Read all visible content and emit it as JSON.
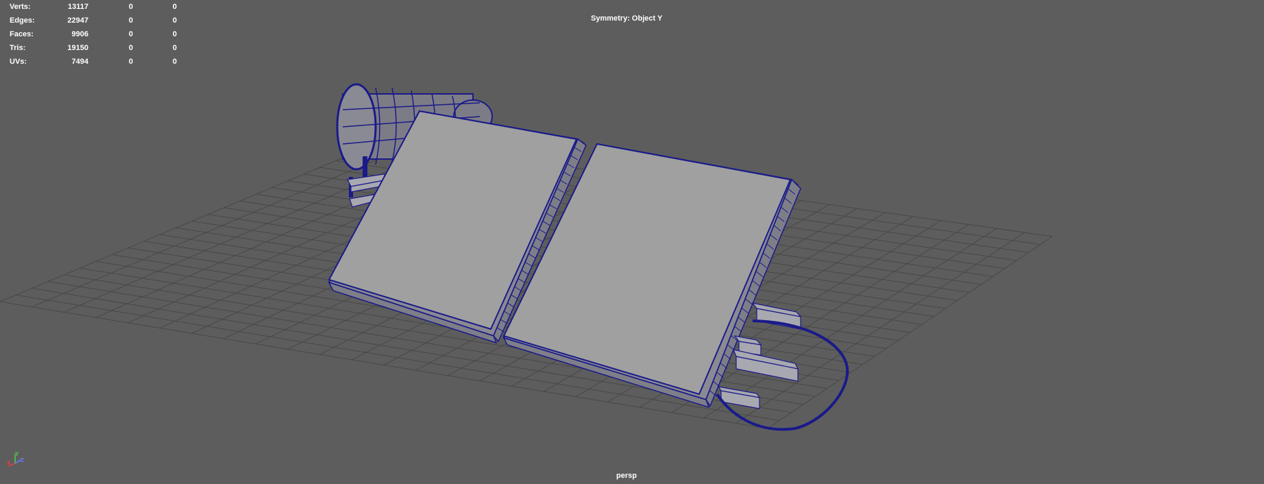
{
  "stats": [
    {
      "label": "Verts:",
      "v1": "13117",
      "v2": "0",
      "v3": "0"
    },
    {
      "label": "Edges:",
      "v1": "22947",
      "v2": "0",
      "v3": "0"
    },
    {
      "label": "Faces:",
      "v1": "9906",
      "v2": "0",
      "v3": "0"
    },
    {
      "label": "Tris:",
      "v1": "19150",
      "v2": "0",
      "v3": "0"
    },
    {
      "label": "UVs:",
      "v1": "7494",
      "v2": "0",
      "v3": "0"
    }
  ],
  "symmetry": "Symmetry: Object Y",
  "camera": "persp",
  "axis": {
    "x": "X",
    "y": "Y",
    "z": "Z"
  },
  "colors": {
    "background": "#5d5d5d",
    "grid": "#4a4a4a",
    "wireframe": "#1a1a8a",
    "panel_face": "#a0a0a0",
    "panel_side": "#8a8a90"
  },
  "icons": {
    "axis_gizmo": "xyz-axis-gizmo-icon"
  }
}
